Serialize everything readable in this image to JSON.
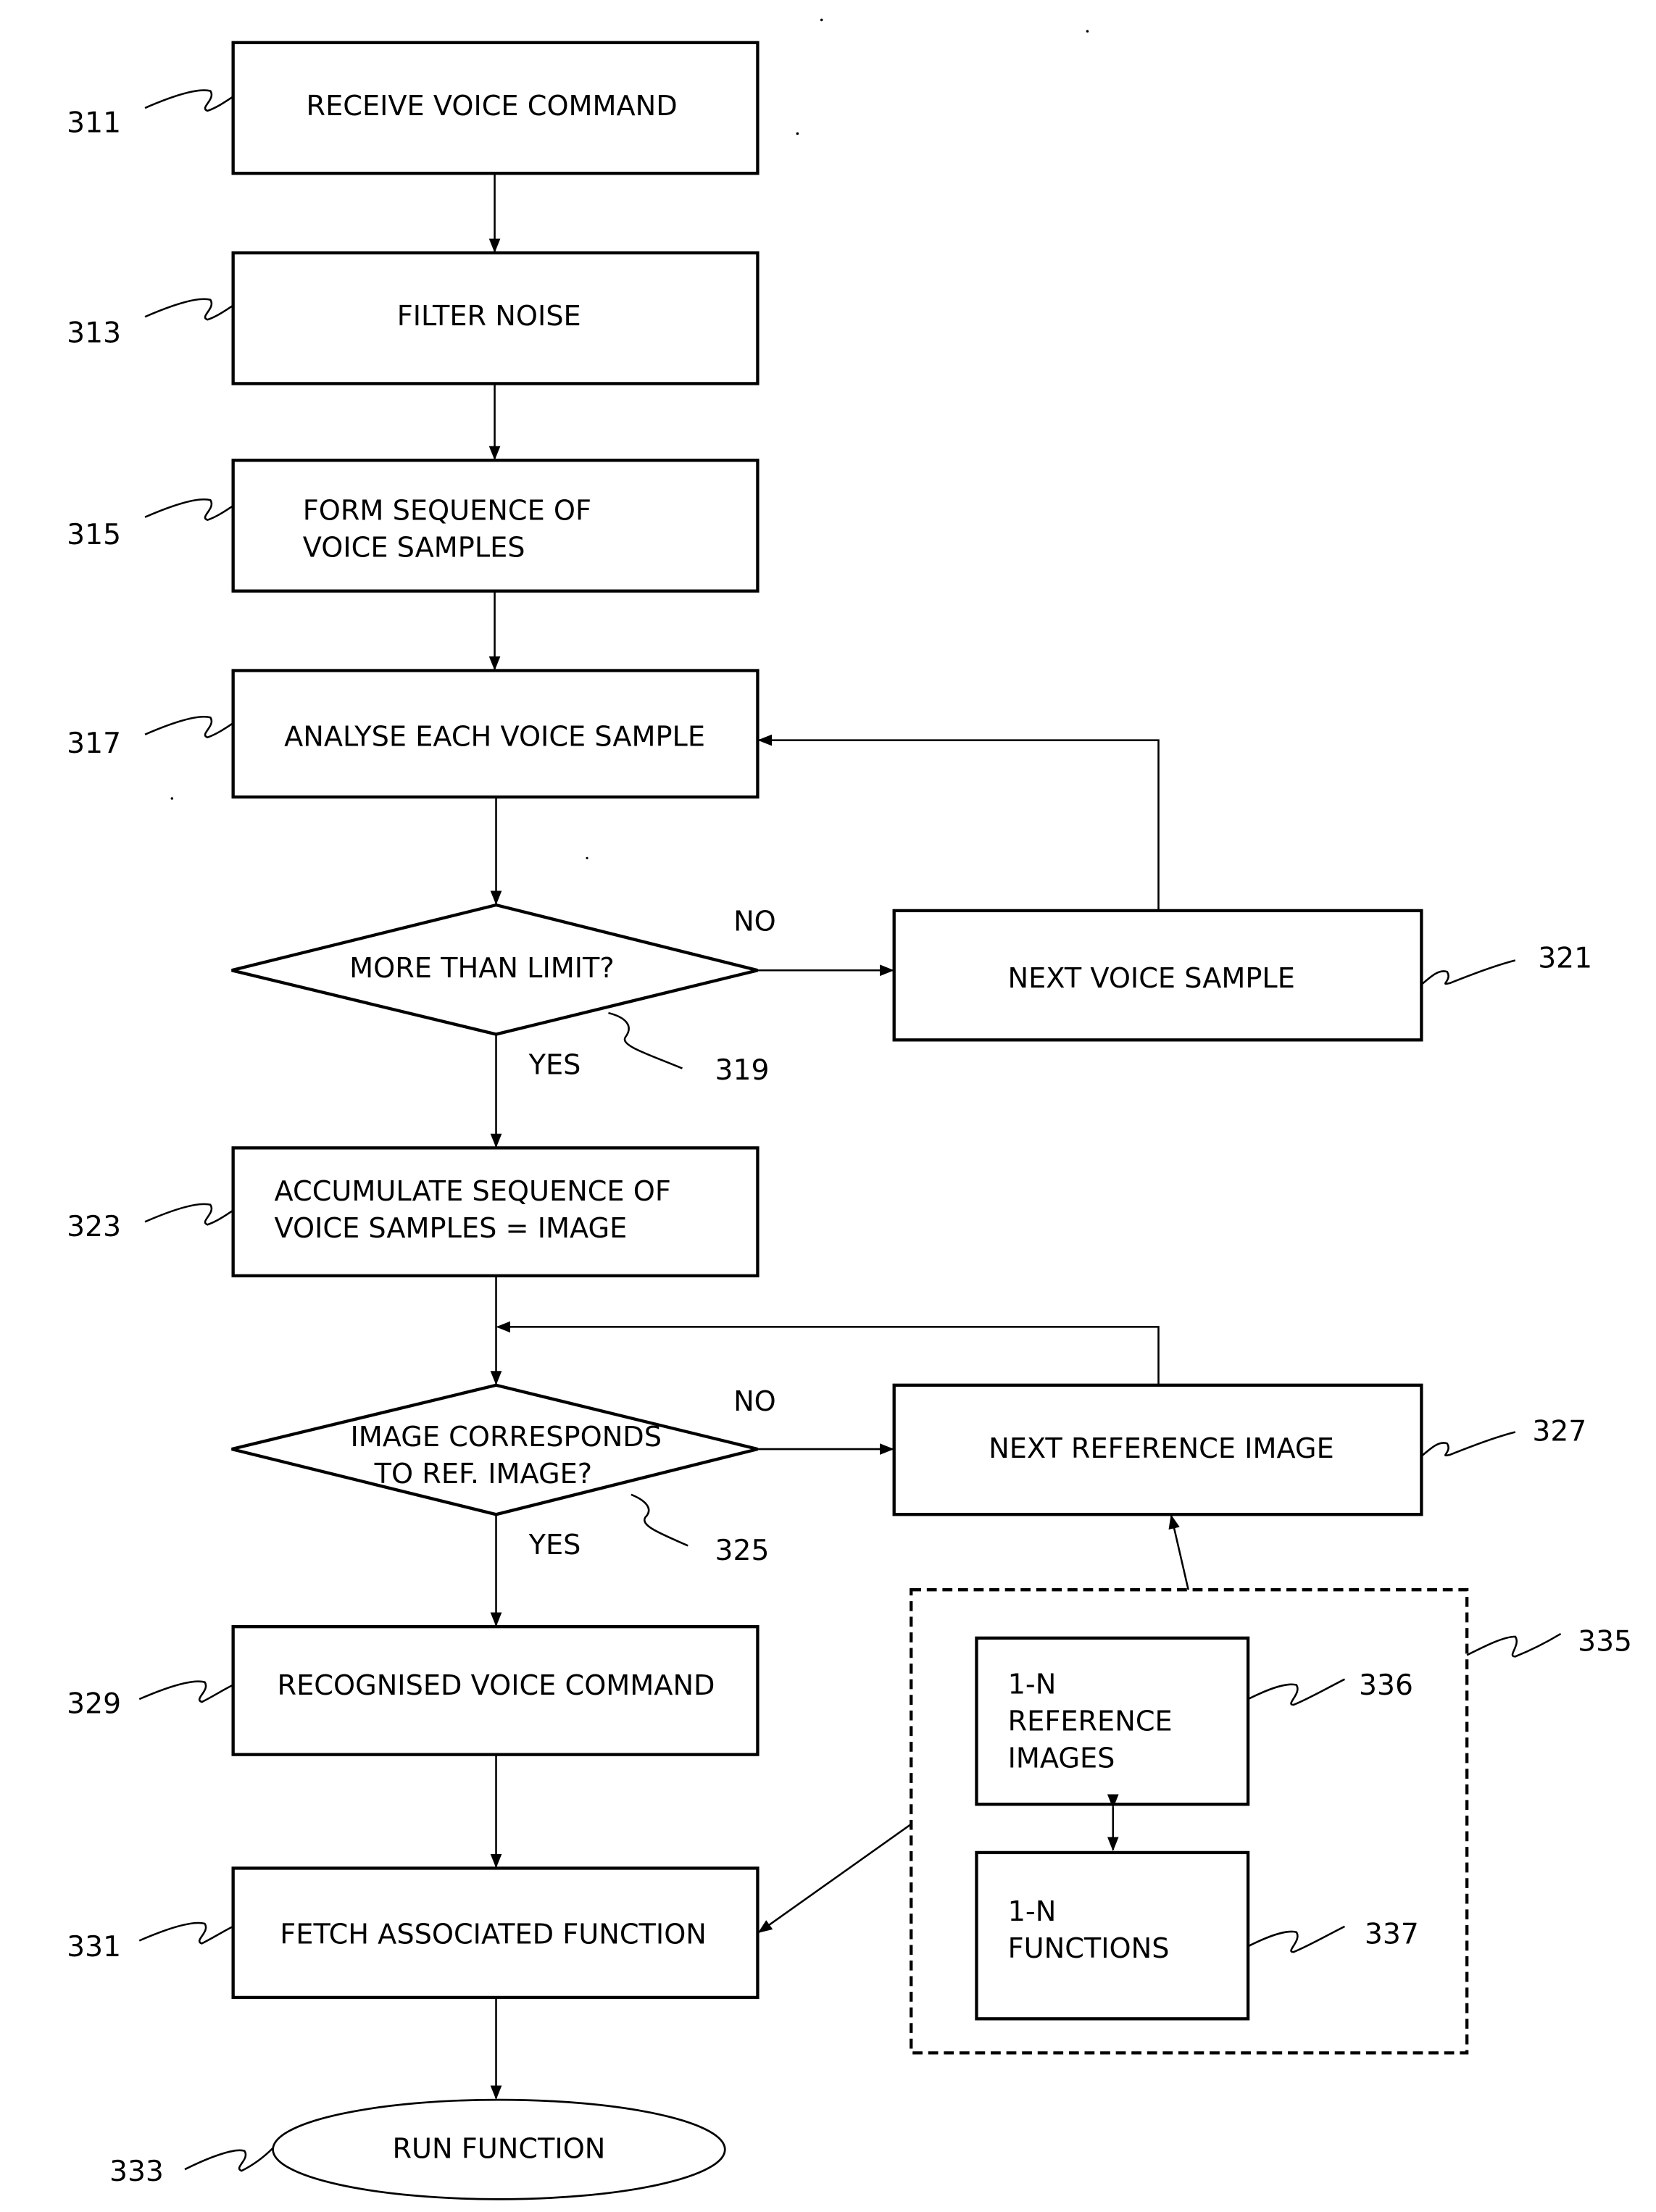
{
  "figure": {
    "steps": {
      "s311": {
        "ref": "311",
        "lines": [
          "RECEIVE VOICE COMMAND"
        ]
      },
      "s313": {
        "ref": "313",
        "lines": [
          "FILTER NOISE"
        ]
      },
      "s315": {
        "ref": "315",
        "lines": [
          "FORM SEQUENCE OF",
          "VOICE SAMPLES"
        ]
      },
      "s317": {
        "ref": "317",
        "lines": [
          "ANALYSE EACH VOICE SAMPLE"
        ]
      },
      "s319": {
        "ref": "319",
        "lines": [
          "MORE THAN LIMIT?"
        ],
        "yes": "YES",
        "no": "NO"
      },
      "s321": {
        "ref": "321",
        "lines": [
          "NEXT VOICE SAMPLE"
        ]
      },
      "s323": {
        "ref": "323",
        "lines": [
          "ACCUMULATE SEQUENCE OF",
          "VOICE SAMPLES = IMAGE"
        ]
      },
      "s325": {
        "ref": "325",
        "lines": [
          "IMAGE CORRESPONDS",
          "TO REF. IMAGE?"
        ],
        "yes": "YES",
        "no": "NO"
      },
      "s327": {
        "ref": "327",
        "lines": [
          "NEXT REFERENCE IMAGE"
        ]
      },
      "s329": {
        "ref": "329",
        "lines": [
          "RECOGNISED VOICE COMMAND"
        ]
      },
      "s331": {
        "ref": "331",
        "lines": [
          "FETCH ASSOCIATED FUNCTION"
        ]
      },
      "s333": {
        "ref": "333",
        "lines": [
          "RUN FUNCTION"
        ]
      },
      "s335": {
        "ref": "335"
      },
      "s336": {
        "ref": "336",
        "lines": [
          "1-N",
          "REFERENCE",
          "IMAGES"
        ]
      },
      "s337": {
        "ref": "337",
        "lines": [
          "1-N",
          "FUNCTIONS"
        ]
      }
    }
  }
}
